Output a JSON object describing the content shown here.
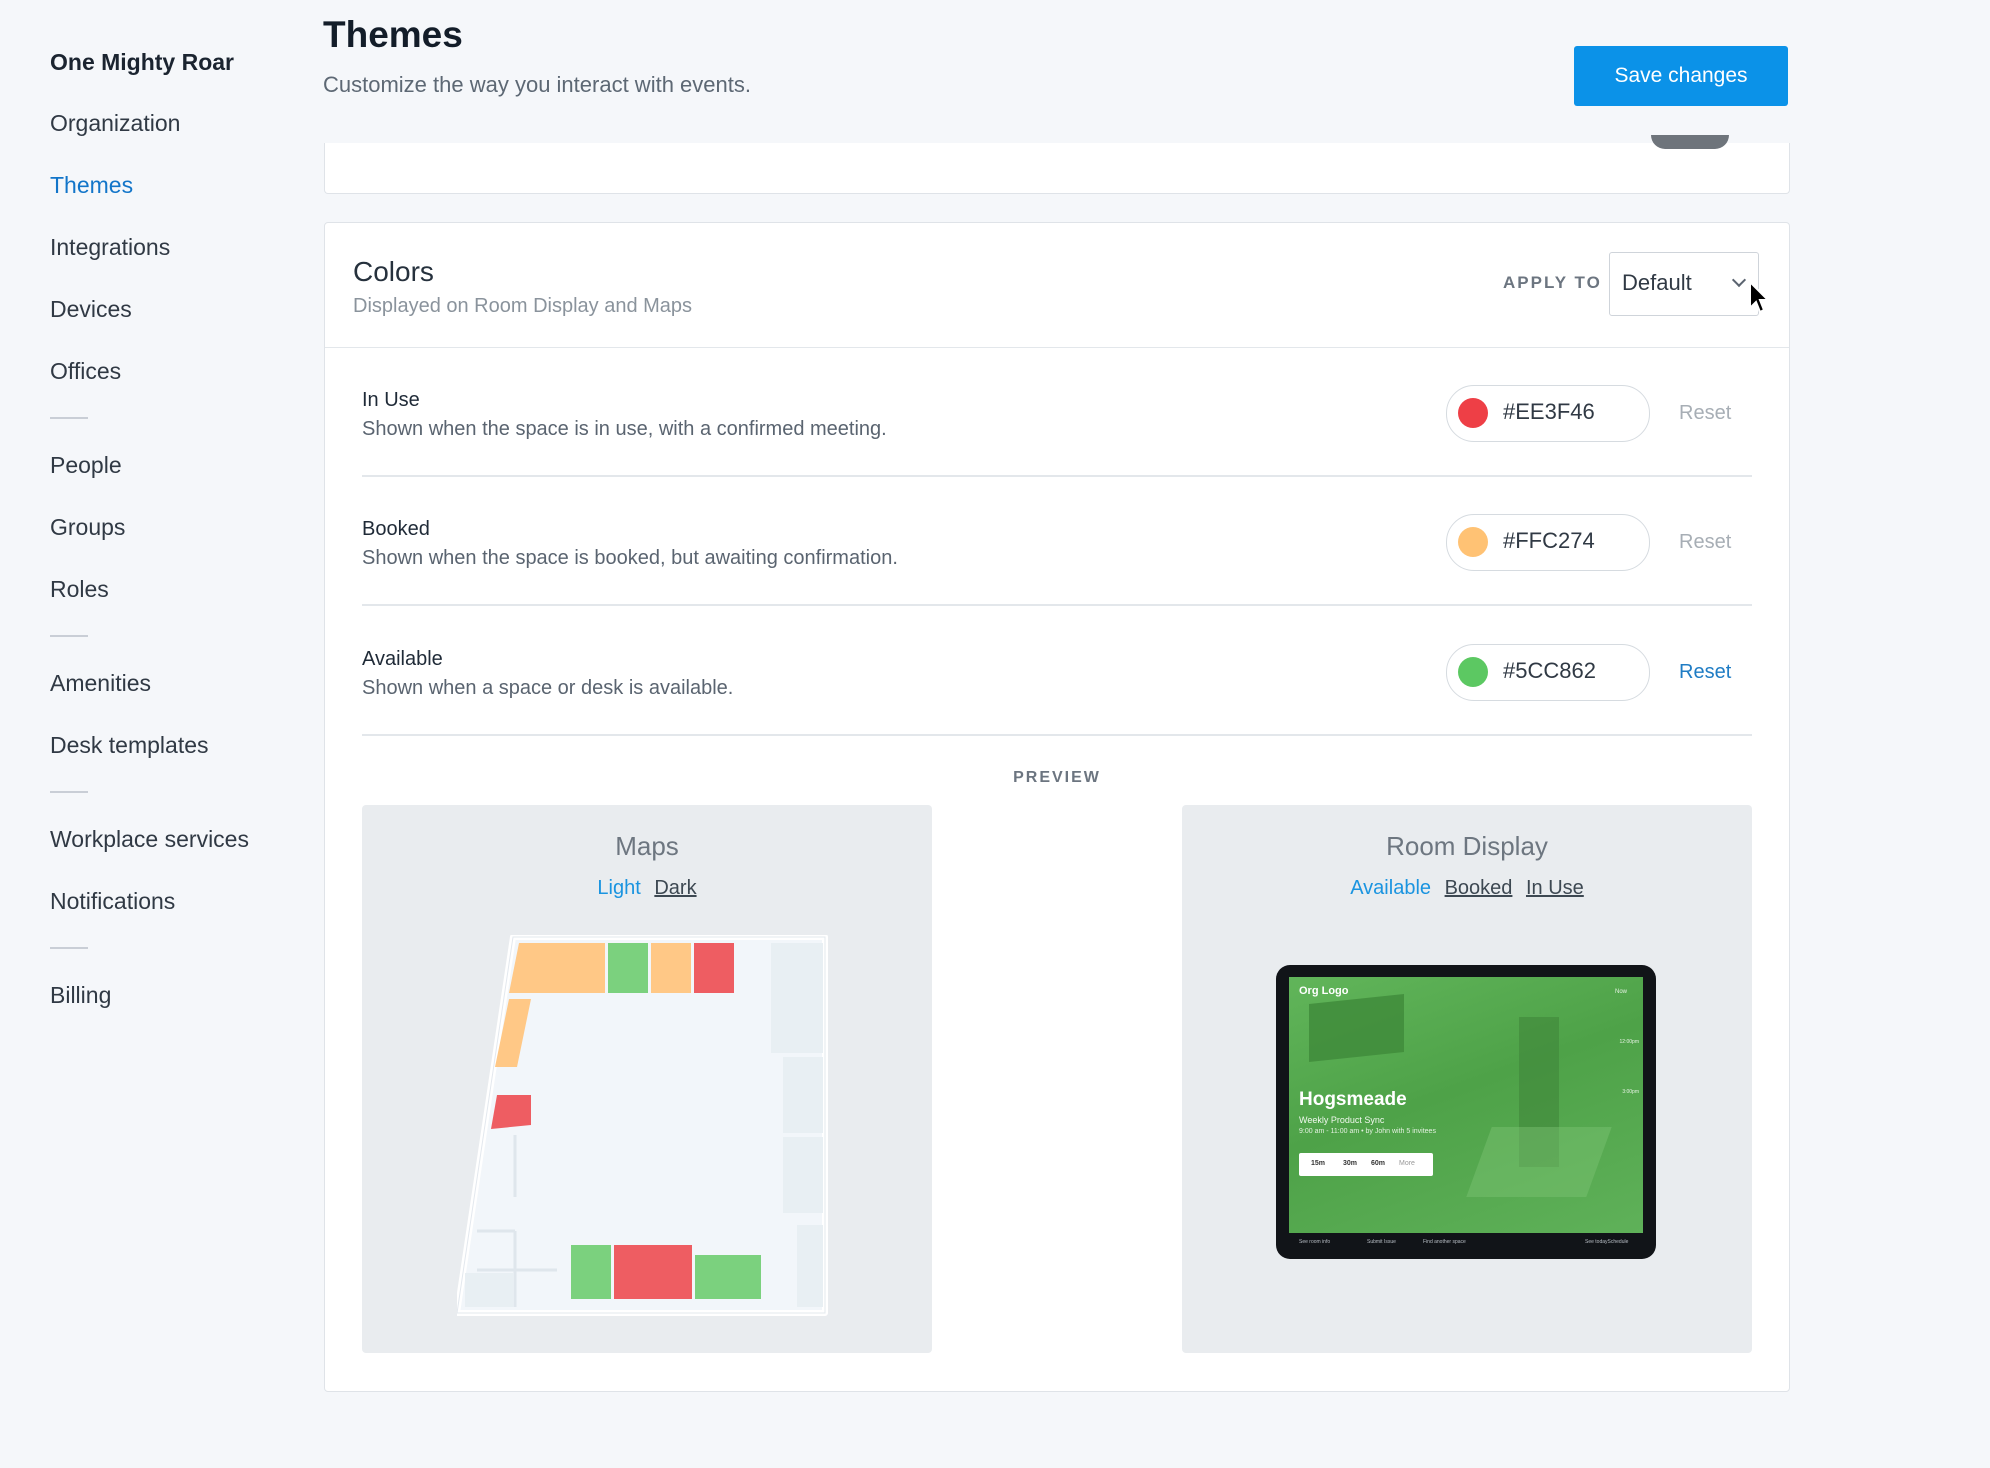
{
  "sidebar": {
    "org_name": "One Mighty Roar",
    "items": [
      "Organization",
      "Themes",
      "Integrations",
      "Devices",
      "Offices",
      "People",
      "Groups",
      "Roles",
      "Amenities",
      "Desk templates",
      "Workplace services",
      "Notifications",
      "Billing"
    ],
    "active": "Themes"
  },
  "header": {
    "title": "Themes",
    "subtitle": "Customize the way you interact with events.",
    "save_label": "Save changes"
  },
  "colors_card": {
    "title": "Colors",
    "subtitle": "Displayed on Room Display and Maps",
    "apply_to_label": "APPLY TO",
    "apply_to_value": "Default",
    "rows": [
      {
        "name": "In Use",
        "description": "Shown when the space is in use, with a confirmed meeting.",
        "hex": "#EE3F46",
        "swatch": "#ee3f46",
        "reset_label": "Reset",
        "reset_enabled": false
      },
      {
        "name": "Booked",
        "description": "Shown when the space is booked, but awaiting confirmation.",
        "hex": "#FFC274",
        "swatch": "#ffc274",
        "reset_label": "Reset",
        "reset_enabled": false
      },
      {
        "name": "Available",
        "description": "Shown when a space or desk is available.",
        "hex": "#5CC862",
        "swatch": "#5cc862",
        "reset_label": "Reset",
        "reset_enabled": true
      }
    ],
    "preview_label": "PREVIEW",
    "maps_preview": {
      "title": "Maps",
      "modes": [
        "Light",
        "Dark"
      ],
      "selected_mode": "Light"
    },
    "room_display_preview": {
      "title": "Room Display",
      "states": [
        "Available",
        "Booked",
        "In Use"
      ],
      "selected_state": "Available",
      "screen": {
        "org_logo": "Org Logo",
        "now_label": "Now",
        "time_1": "12:00pm",
        "time_2": "3:00pm",
        "room_name": "Hogsmeade",
        "meeting_title": "Weekly Product Sync",
        "meeting_time": "9:00 am - 11:00 am • by John with 5 invitees",
        "durations": [
          "15m",
          "30m",
          "60m",
          "More"
        ],
        "footer_items": [
          "See room info",
          "Submit Issue",
          "Find another space",
          "See todaySchedule"
        ]
      }
    }
  }
}
